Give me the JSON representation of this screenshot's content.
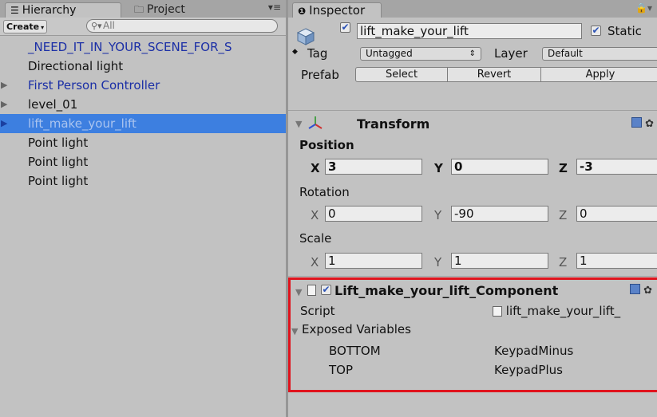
{
  "hierarchy": {
    "tab_label": "Hierarchy",
    "project_tab_label": "Project",
    "create_label": "Create",
    "search_placeholder": "All",
    "items": [
      {
        "label": "_NEED_IT_IN_YOUR_SCENE_FOR_S",
        "color": "blue"
      },
      {
        "label": "Directional light",
        "color": "black"
      },
      {
        "label": "First Person Controller",
        "color": "blue",
        "foldout": true
      },
      {
        "label": "level_01",
        "color": "black",
        "foldout": true
      },
      {
        "label": "lift_make_your_lift",
        "color": "selected",
        "foldout": true
      },
      {
        "label": "Point light",
        "color": "black"
      },
      {
        "label": "Point light",
        "color": "black"
      },
      {
        "label": "Point light",
        "color": "black"
      }
    ]
  },
  "inspector": {
    "tab_label": "Inspector",
    "object_name": "lift_make_your_lift",
    "active": true,
    "static_label": "Static",
    "static_checked": true,
    "tag_label": "Tag",
    "tag_value": "Untagged",
    "layer_label": "Layer",
    "layer_value": "Default",
    "prefab_label": "Prefab",
    "prefab_select": "Select",
    "prefab_revert": "Revert",
    "prefab_apply": "Apply",
    "transform": {
      "title": "Transform",
      "position_label": "Position",
      "position": {
        "x": "3",
        "y": "0",
        "z": "-3"
      },
      "rotation_label": "Rotation",
      "rotation": {
        "x": "0",
        "y": "-90",
        "z": "0"
      },
      "scale_label": "Scale",
      "scale": {
        "x": "1",
        "y": "1",
        "z": "1"
      },
      "axis_x": "X",
      "axis_y": "Y",
      "axis_z": "Z"
    },
    "component": {
      "title": "Lift_make_your_lift_Component",
      "enabled": true,
      "script_label": "Script",
      "script_value": "lift_make_your_lift_",
      "exposed_label": "Exposed Variables",
      "variables": [
        {
          "name": "BOTTOM",
          "value": "KeypadMinus"
        },
        {
          "name": "TOP",
          "value": "KeypadPlus"
        }
      ]
    }
  },
  "colors": {
    "panel_bg": "#c2c2c2",
    "selection": "#3d7fe0",
    "link_blue": "#1b2fa6",
    "highlight_red": "#e0131d"
  }
}
